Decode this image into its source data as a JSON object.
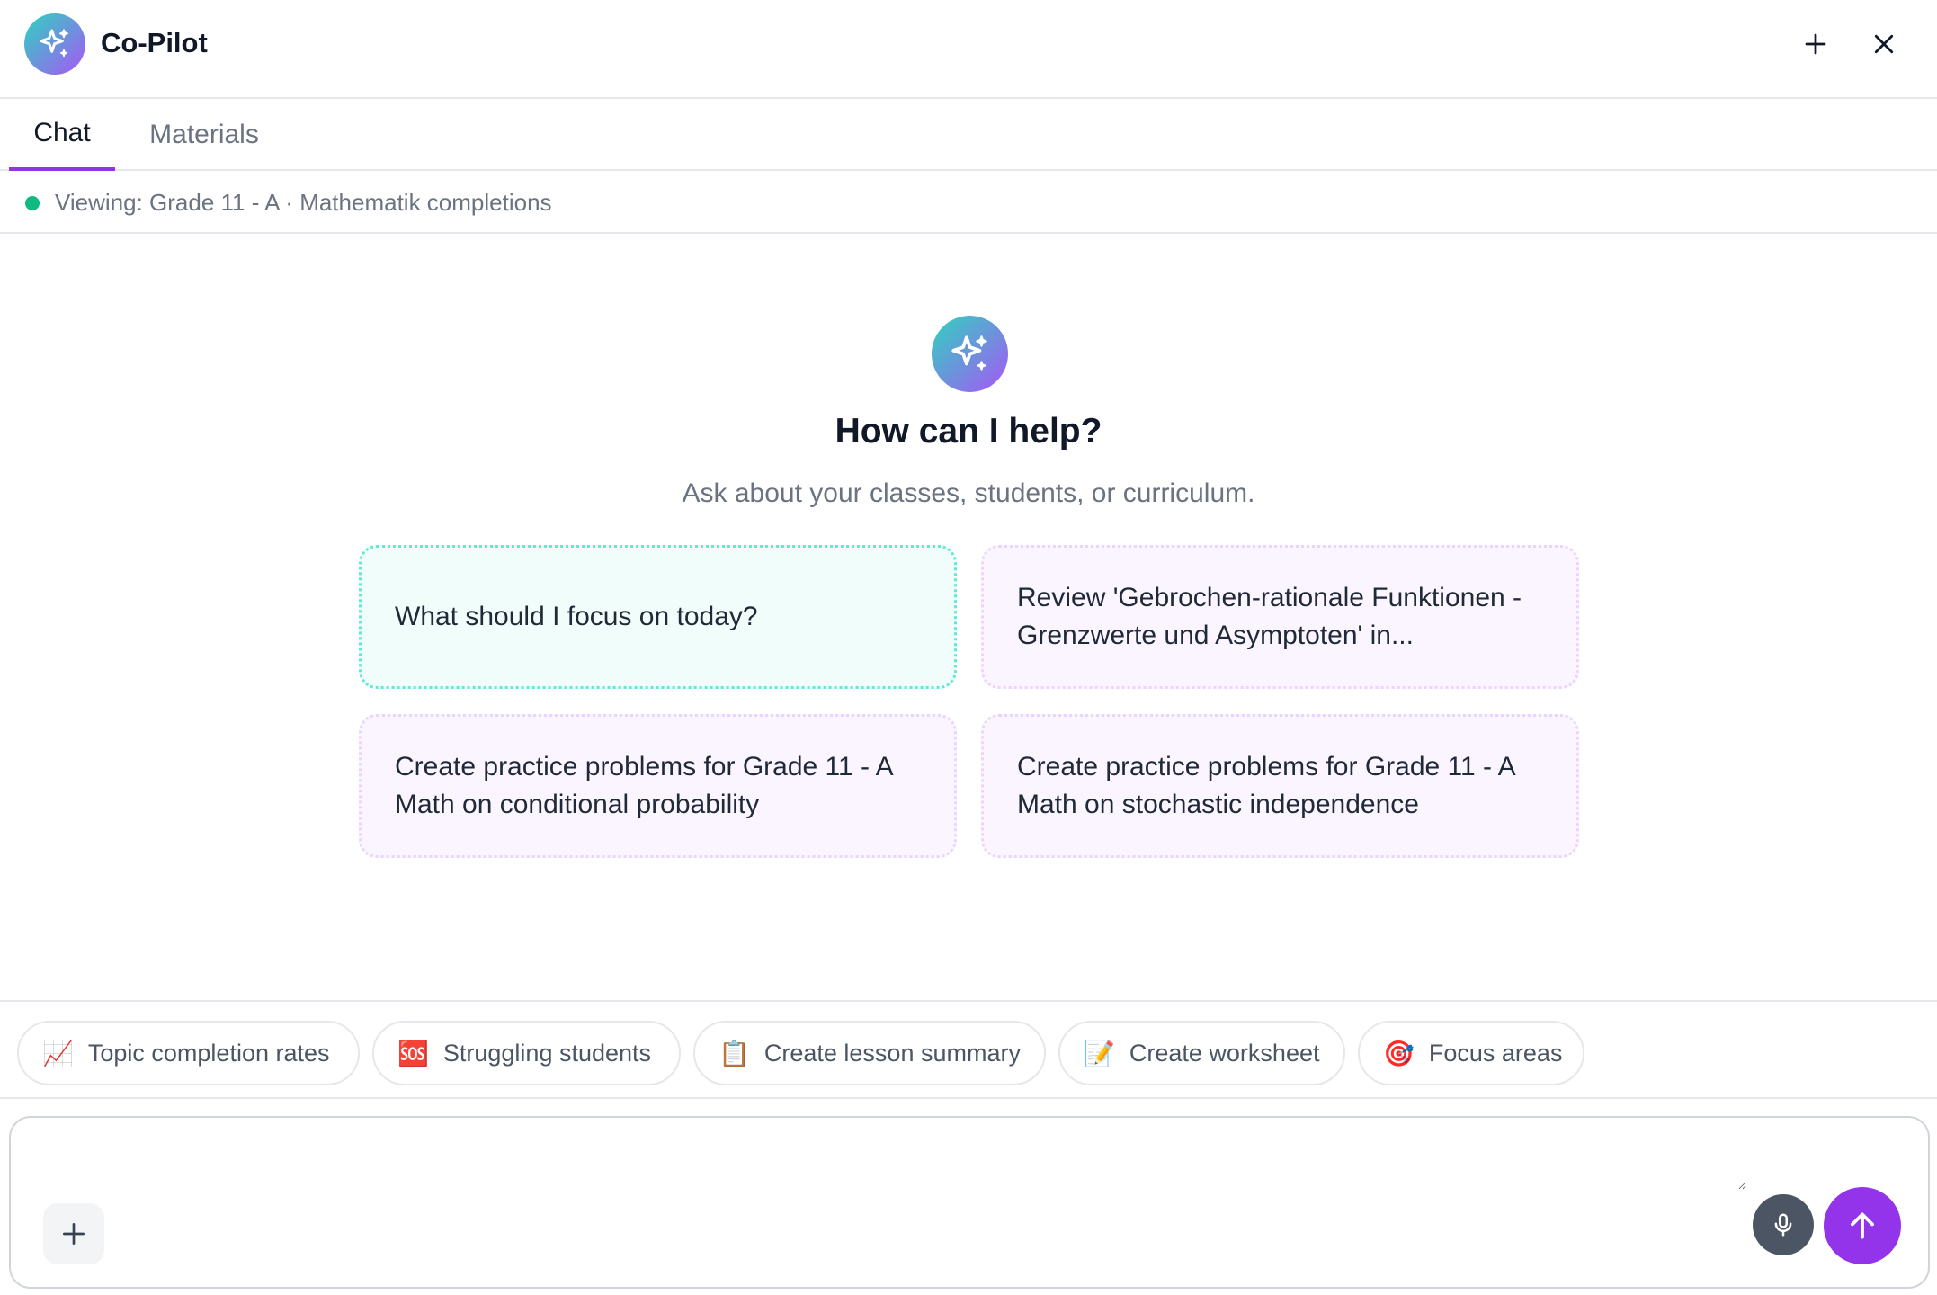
{
  "app": {
    "title": "Co-Pilot"
  },
  "header": {
    "new_chat_icon": "plus-icon",
    "close_icon": "close-icon"
  },
  "tabs": [
    {
      "label": "Chat",
      "active": true
    },
    {
      "label": "Materials",
      "active": false
    }
  ],
  "context": {
    "text": "Viewing: Grade 11 - A · Mathematik completions",
    "status_color": "#10b981"
  },
  "welcome": {
    "heading": "How can I help?",
    "subheading": "Ask about your classes, students, or curriculum."
  },
  "suggestions": [
    {
      "text": "What should I focus on today?",
      "style": "primary"
    },
    {
      "text": "Review 'Gebrochen-rationale Funktionen - Grenzwerte und Asymptoten' in...",
      "style": "secondary"
    },
    {
      "text": "Create practice problems for Grade 11 - A Math on conditional probability",
      "style": "secondary"
    },
    {
      "text": "Create practice problems for Grade 11 - A Math on stochastic independence",
      "style": "secondary"
    }
  ],
  "quick_actions": [
    {
      "emoji": "📈",
      "label": "Topic completion rates",
      "icon": "chart-increasing-icon"
    },
    {
      "emoji": "🆘",
      "label": "Struggling students",
      "icon": "sos-icon"
    },
    {
      "emoji": "📋",
      "label": "Create lesson summary",
      "icon": "clipboard-icon"
    },
    {
      "emoji": "📝",
      "label": "Create worksheet",
      "icon": "memo-icon"
    },
    {
      "emoji": "🎯",
      "label": "Focus areas",
      "icon": "target-icon"
    }
  ],
  "composer": {
    "value": "",
    "placeholder": "",
    "attach_icon": "plus-icon",
    "mic_icon": "microphone-icon",
    "send_icon": "arrow-up-icon"
  },
  "colors": {
    "accent": "#9333ea",
    "brand_gradient_start": "#2dd4bf",
    "brand_gradient_end": "#a855f7"
  }
}
